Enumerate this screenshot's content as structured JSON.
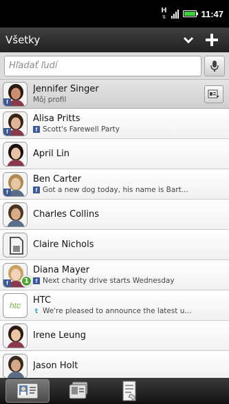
{
  "status": {
    "network": "H",
    "time": "11:47"
  },
  "header": {
    "title": "Všetky"
  },
  "search": {
    "placeholder": "Hľadať ľudí"
  },
  "contacts": [
    {
      "name": "Jennifer Singer",
      "sub": "Môj profil",
      "sub_icon": "none",
      "avatar": "woman-dark-hair",
      "me": true
    },
    {
      "name": "Alisa Pritts",
      "sub": "Scott's Farewell Party",
      "sub_icon": "facebook",
      "avatar": "woman-smiling"
    },
    {
      "name": "April Lin",
      "sub": "",
      "sub_icon": "none",
      "avatar": "woman-asian"
    },
    {
      "name": "Ben Carter",
      "sub": "Got a new dog today, his name is Bart...",
      "sub_icon": "facebook",
      "avatar": "man-blonde"
    },
    {
      "name": "Charles Collins",
      "sub": "",
      "sub_icon": "none",
      "avatar": "man-outdoor"
    },
    {
      "name": "Claire Nichols",
      "sub": "",
      "sub_icon": "none",
      "avatar": "sim-card"
    },
    {
      "name": "Diana Mayer",
      "sub": "Next charity drive starts Wednesday",
      "sub_icon": "facebook",
      "avatar": "woman-blonde",
      "badge": "1"
    },
    {
      "name": "HTC",
      "sub": "We're pleased to announce the latest u...",
      "sub_icon": "twitter",
      "avatar": "htc-logo",
      "logo_text": "htc"
    },
    {
      "name": "Irene Leung",
      "sub": "",
      "sub_icon": "none",
      "avatar": "woman-asian-2"
    },
    {
      "name": "Jason Holt",
      "sub": "",
      "sub_icon": "none",
      "avatar": "man-suit"
    }
  ],
  "tabs": [
    {
      "name": "people-tab",
      "icon": "contact-card-icon",
      "active": true
    },
    {
      "name": "groups-tab",
      "icon": "group-cards-icon",
      "active": false
    },
    {
      "name": "call-history-tab",
      "icon": "call-log-icon",
      "active": false
    }
  ],
  "colors": {
    "facebook": "#3b5998",
    "twitter": "#3fa9dd",
    "badge": "#4ea72e",
    "battery": "#3bd13b"
  }
}
